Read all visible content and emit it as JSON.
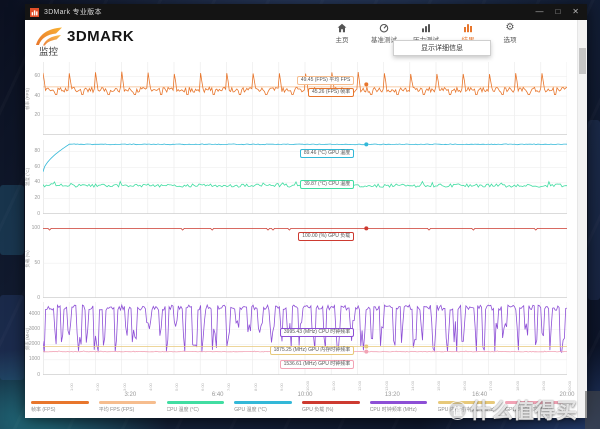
{
  "window": {
    "title": "3DMark 专业版本",
    "minimize": "—",
    "maximize": "□",
    "close": "✕"
  },
  "header": {
    "logo_text": "3DMARK",
    "section_title": "监控"
  },
  "nav": {
    "items": [
      {
        "id": "home",
        "label": "主页"
      },
      {
        "id": "benchmark",
        "label": "基准测试"
      },
      {
        "id": "stress",
        "label": "压力测试"
      },
      {
        "id": "results",
        "label": "结果",
        "active": true
      },
      {
        "id": "options",
        "label": "选项"
      }
    ],
    "dropdown_label": "显示详细信息",
    "active_color": "#e8762c"
  },
  "cursor": {
    "fx": 0.617
  },
  "chart_data": [
    {
      "type": "line",
      "ylabel": "帧率 (FPS)",
      "ylim": [
        0,
        75
      ],
      "yticks": [
        20,
        40,
        60
      ],
      "xlabel": "",
      "grid": true,
      "legend_position": "bottom",
      "series": [
        {
          "name": "平均 FPS",
          "unit": "FPS",
          "color": "#f6bd8e",
          "pattern": "flat",
          "value": 49.45,
          "tooltip": "49.45 (FPS) 平均 FPS",
          "cursor_value": 49.45,
          "dot": false
        },
        {
          "name": "帧率",
          "unit": "FPS",
          "color": "#e8762c",
          "pattern": "spiky",
          "base": 46.5,
          "amp": 2.6,
          "spike": 64,
          "dip": 41.5,
          "loops": 20,
          "tooltip": "45.26 (FPS) 帧率",
          "cursor_value": 52,
          "dot": true
        }
      ]
    },
    {
      "type": "line",
      "ylabel": "温度 (°C)",
      "ylim": [
        0,
        95
      ],
      "yticks": [
        0,
        20,
        40,
        60,
        80
      ],
      "xlabel": "",
      "grid": true,
      "series": [
        {
          "name": "CPU 温度",
          "unit": "°C",
          "color": "#41dda2",
          "pattern": "noisy",
          "value": 36.5,
          "amp": 2.1,
          "tooltip": "39.87 (°C) CPU 温度",
          "cursor_value": 39.87,
          "dot": false
        },
        {
          "name": "GPU 温度",
          "unit": "°C",
          "color": "#33b8d8",
          "pattern": "risehold",
          "start": 54,
          "value": 89.46,
          "rise_frac": 0.05,
          "amp": 0.5,
          "tooltip": "89.46 (°C) GPU 温度",
          "cursor_value": 89.46,
          "dot": true
        }
      ]
    },
    {
      "type": "line",
      "ylabel": "负载 (%)",
      "ylim": [
        0,
        112
      ],
      "yticks": [
        0,
        50,
        100
      ],
      "xlabel": "",
      "grid": true,
      "series": [
        {
          "name": "GPU 负载",
          "unit": "%",
          "color": "#cd3a30",
          "pattern": "load",
          "value": 100,
          "dip_value": 97.5,
          "tooltip": "100.00 (%) GPU 负载",
          "cursor_value": 100,
          "dot": true
        }
      ]
    },
    {
      "type": "line",
      "ylabel": "频率 (MHz)",
      "ylim": [
        0,
        4800
      ],
      "yticks": [
        0,
        1000,
        2000,
        3000,
        4000
      ],
      "xlabel": "",
      "grid": true,
      "series": [
        {
          "name": "CPU 时钟频率",
          "unit": "MHz",
          "color": "#8d4fd6",
          "pattern": "oscillate",
          "hi": 4430,
          "hi_amp": 170,
          "lo_min": 1500,
          "lo_max": 3600,
          "tooltip": "3995.43 (MHz) CPU 时钟频率",
          "cursor_value": 3995.43,
          "dot": false
        },
        {
          "name": "GPU 内存时钟频率",
          "unit": "MHz",
          "color": "#e7c97a",
          "pattern": "flat",
          "value": 1875.25,
          "tooltip": "1875.25 (MHz) GPU 内存时钟频率",
          "cursor_value": 1875.25,
          "dot": true
        },
        {
          "name": "GPU 时钟频率",
          "unit": "MHz",
          "color": "#f2a3b5",
          "pattern": "noisy",
          "value": 1536.61,
          "amp": 18,
          "tooltip": "1536.61 (MHz) GPU 时钟频率",
          "cursor_value": 1536.61,
          "dot": true
        }
      ]
    }
  ],
  "x_axis": {
    "major_labels": [
      "3:20",
      "6:40",
      "10:00",
      "13:20",
      "16:40",
      "20:00"
    ],
    "minor_labels": [
      "1:00",
      "2:00",
      "3:00",
      "4:00",
      "5:00",
      "6:00",
      "7:00",
      "8:00",
      "9:00",
      "10:00",
      "11:00",
      "12:00",
      "13:00",
      "14:00",
      "15:00",
      "16:00",
      "17:00",
      "18:00",
      "19:00",
      "20:00"
    ],
    "total_duration": "20:00"
  },
  "legend": [
    {
      "label": "帧率 (FPS)",
      "color": "#e8762c"
    },
    {
      "label": "平均 FPS (FPS)",
      "color": "#f6bd8e"
    },
    {
      "label": "CPU 温度 (°C)",
      "color": "#41dda2"
    },
    {
      "label": "GPU 温度 (°C)",
      "color": "#33b8d8"
    },
    {
      "label": "GPU 负载 (%)",
      "color": "#cd3a30"
    },
    {
      "label": "CPU 时钟频率 (MHz)",
      "color": "#8d4fd6"
    },
    {
      "label": "GPU 内存时钟频率 (MHz)",
      "color": "#e7c97a"
    },
    {
      "label": "GPU 时钟频率 (MHz)",
      "color": "#f2a3b5"
    }
  ],
  "watermark": {
    "badge": "值",
    "text": "什么值得买"
  }
}
